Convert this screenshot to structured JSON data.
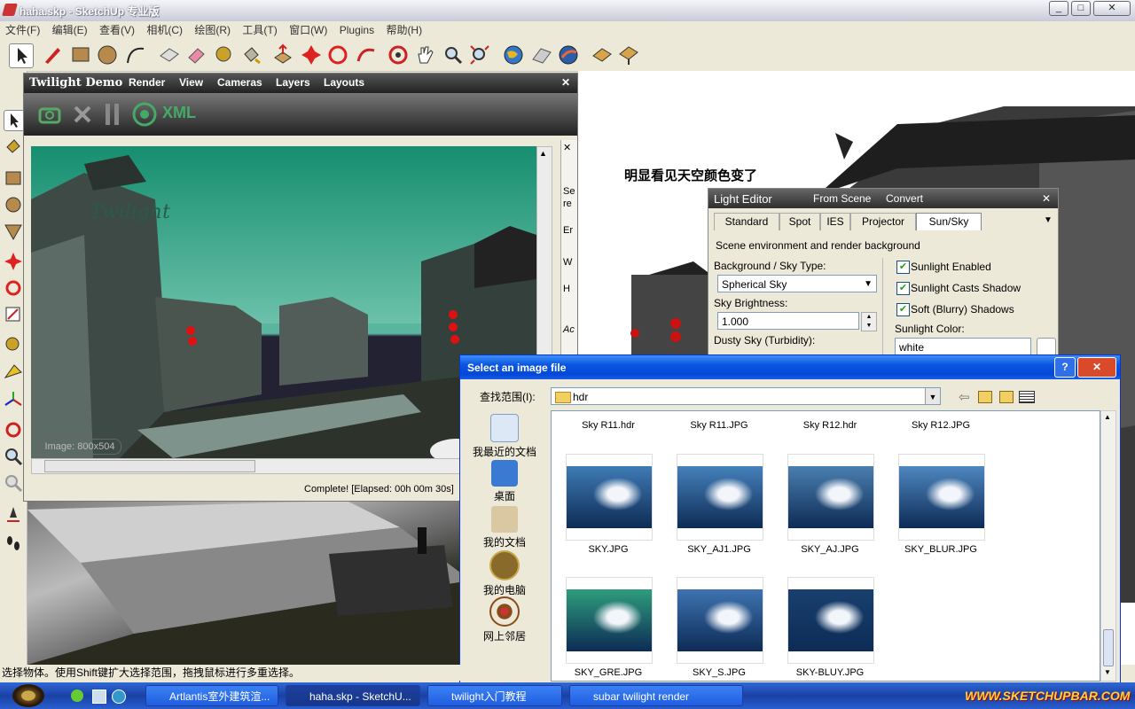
{
  "app": {
    "title": "haha.skp - SketchUp 专业版",
    "window_buttons": [
      "_",
      "□",
      "✕"
    ],
    "menus": [
      "文件(F)",
      "编辑(E)",
      "查看(V)",
      "相机(C)",
      "绘图(R)",
      "工具(T)",
      "窗口(W)",
      "Plugins",
      "帮助(H)"
    ],
    "status_bar": "选择物体。使用Shift键扩大选择范围，拖拽鼠标进行多重选择。",
    "annotation": "明显看见天空颜色变了"
  },
  "twilight": {
    "title": "Twilight Demo",
    "menu": [
      "Render",
      "View",
      "Cameras",
      "Layers",
      "Layouts"
    ],
    "close": "✕",
    "xml_label": "XML",
    "watermark": "Twilight",
    "image_info": "Image: 800x504",
    "status": "Complete!  [Elapsed: 00h 00m 30s]"
  },
  "side_panel": {
    "lines": [
      "Se",
      "re",
      "Er",
      "W",
      "H",
      "Ac"
    ]
  },
  "light_editor": {
    "title": "Light Editor",
    "from_scene": "From Scene",
    "convert": "Convert",
    "tabs": [
      "Standard",
      "Spot",
      "IES",
      "Projector",
      "Sun/Sky"
    ],
    "active_tab": "Sun/Sky",
    "description": "Scene environment and render background",
    "background_label": "Background / Sky Type:",
    "background_value": "Spherical Sky",
    "brightness_label": "Sky Brightness:",
    "brightness_value": "1.000",
    "dusty_label": "Dusty Sky (Turbidity):",
    "checks": [
      {
        "label": "Sunlight Enabled",
        "checked": true
      },
      {
        "label": "Sunlight Casts Shadow",
        "checked": true
      },
      {
        "label": "Soft (Blurry) Shadows",
        "checked": true
      }
    ],
    "color_label": "Sunlight Color:",
    "color_value": "white"
  },
  "dialog": {
    "title": "Select an image file",
    "lookin_label": "查找范围(I):",
    "lookin_value": "hdr",
    "places": [
      "我最近的文档",
      "桌面",
      "我的文档",
      "我的电脑",
      "网上邻居"
    ],
    "top_row": [
      "Sky R11.hdr",
      "Sky R11.JPG",
      "Sky R12.hdr",
      "Sky R12.JPG"
    ],
    "files": [
      {
        "name": "SKY.JPG",
        "tone": "#3f7bb5"
      },
      {
        "name": "SKY_AJ1.JPG",
        "tone": "#4581bb"
      },
      {
        "name": "SKY_AJ.JPG",
        "tone": "#4a7fb0"
      },
      {
        "name": "SKY_BLUR.JPG",
        "tone": "#4e87c0"
      },
      {
        "name": "SKY_GRE.JPG",
        "tone": "#2e9d7c"
      },
      {
        "name": "SKY_S.JPG",
        "tone": "#3e73b0"
      },
      {
        "name": "SKY-BLUY.JPG",
        "tone": "#19406e"
      }
    ]
  },
  "taskbar": {
    "items": [
      "Artlantis室外建筑渲...",
      "haha.skp - SketchU...",
      "twilight入门教程",
      "subar twilight  render"
    ],
    "logo": "WWW.SKETCHUPBAR.COM"
  }
}
